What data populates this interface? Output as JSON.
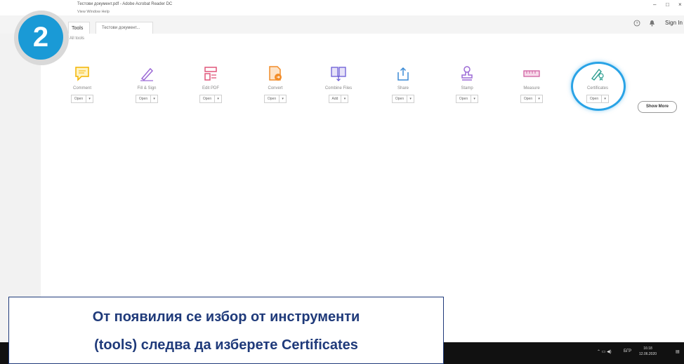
{
  "window": {
    "title": "Тестови документ.pdf - Adobe Acrobat Reader DC",
    "menu": "View   Window   Help",
    "controls": [
      "–",
      "□",
      "×"
    ]
  },
  "tabs": [
    {
      "label": "Tools"
    },
    {
      "label": "Тестови документ..."
    }
  ],
  "header": {
    "help_icon": "?",
    "bell_icon": "bell",
    "sign_in": "Sign In"
  },
  "subheading": "All tools",
  "tools": [
    {
      "name": "Comment",
      "action": "Open",
      "color": "#f4b400"
    },
    {
      "name": "Fill & Sign",
      "action": "Open",
      "color": "#9c6ad6"
    },
    {
      "name": "Edit PDF",
      "action": "Open",
      "color": "#e0567a"
    },
    {
      "name": "Convert",
      "action": "Open",
      "color": "#f28c28"
    },
    {
      "name": "Combine Files",
      "action": "Add",
      "color": "#6a5ad6"
    },
    {
      "name": "Share",
      "action": "Open",
      "color": "#3a8ad6"
    },
    {
      "name": "Stamp",
      "action": "Open",
      "color": "#9c6ad6"
    },
    {
      "name": "Measure",
      "action": "Open",
      "color": "#d05fa0"
    },
    {
      "name": "Certificates",
      "action": "Open",
      "color": "#2a9d8f"
    }
  ],
  "show_more": "Show More",
  "taskbar": {
    "lang": "БГР",
    "time": "16:18",
    "date": "12.06.2020"
  },
  "step": {
    "number": "2"
  },
  "caption": {
    "line1": "От появилия се избор от инструменти",
    "line2": "(tools) следва да изберете Certificates"
  },
  "colors": {
    "accent": "#1a9ad6",
    "caption_text": "#1f3a7a"
  }
}
